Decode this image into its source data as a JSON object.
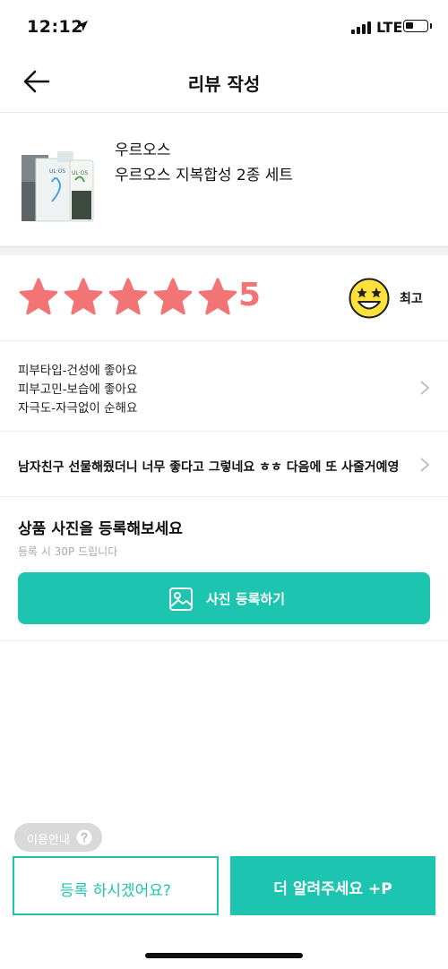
{
  "status_bar": {
    "time": "12:12",
    "network": "LTE",
    "icons": [
      "location-arrow-icon",
      "signal-bars-icon",
      "battery-icon"
    ]
  },
  "header": {
    "title": "리뷰 작성",
    "back_icon": "back-arrow-icon"
  },
  "product": {
    "brand": "우르오스",
    "name": "우르오스 지복합성 2종 세트",
    "image_label": "UL·OS"
  },
  "rating": {
    "stars": 5,
    "max_stars": 5,
    "value": "5",
    "word": "최고",
    "star_color": "#f27475",
    "emoji": "star-eyes-face-icon"
  },
  "attributes": {
    "lines": [
      "피부타입-건성에 좋아요",
      "피부고민-보습에 좋아요",
      "자극도-자극없이 순해요"
    ]
  },
  "review": {
    "text": "남자친구 선물해줬더니 너무 좋다고 그렇네요 ㅎㅎ 다음에 또 사줄거예영"
  },
  "photo": {
    "title": "상품 사진을 등록해보세요",
    "subtitle": "등록 시 30P 드립니다",
    "button_label": "사진 등록하기"
  },
  "footer": {
    "info_label": "이용안내",
    "register_label": "등록 하시겠어요?",
    "more_label": "더 알려주세요 +P"
  },
  "colors": {
    "accent": "#1dc5b0",
    "star": "#f27475",
    "emoji": "#ffe03d"
  }
}
